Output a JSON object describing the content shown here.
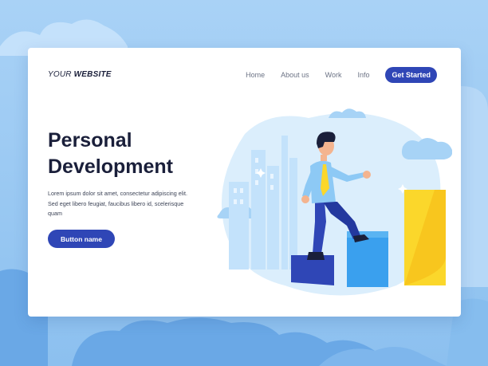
{
  "header": {
    "logo_prefix": "YOUR ",
    "logo_strong": "WEBSITE",
    "nav": [
      "Home",
      "About us",
      "Work",
      "Info"
    ],
    "cta_label": "Get Started"
  },
  "hero": {
    "title_line1": "Personal",
    "title_line2": "Development",
    "description": "Lorem ipsum dolor sit amet, consectetur adipiscing elit. Sed eget libero feugiat, faucibus libero id, scelerisque quam",
    "button_label": "Button name"
  },
  "illustration": {
    "subject": "businessman climbing ascending bar steps",
    "icon_names": [
      "city-skyline-icon",
      "cloud-icon",
      "person-climbing-icon",
      "bar-steps-icon"
    ]
  },
  "colors": {
    "primary": "#2f46b6",
    "accent_yellow": "#fbd72b",
    "background": "#9ccbf3"
  }
}
